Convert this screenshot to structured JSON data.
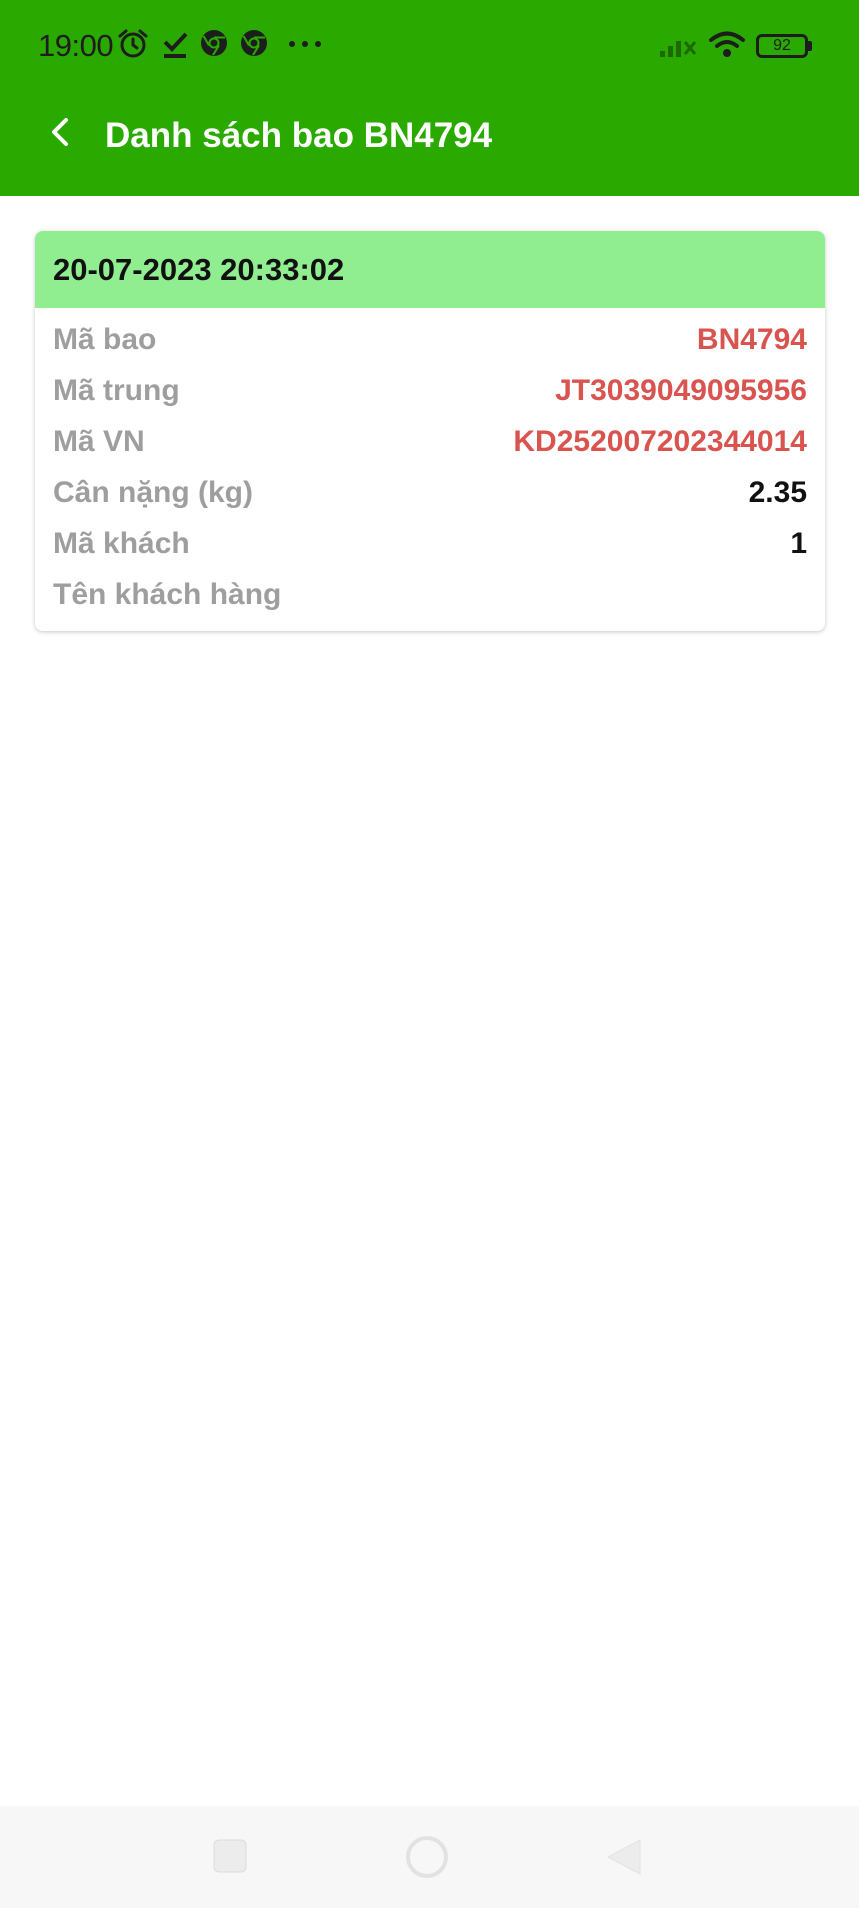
{
  "status_bar": {
    "time": "19:00",
    "battery": "92",
    "icons": [
      "alarm-icon",
      "download-done-icon",
      "chrome-icon",
      "chrome-icon",
      "more-dots-icon",
      "signal-icon",
      "wifi-icon",
      "battery-icon"
    ]
  },
  "app_bar": {
    "title": "Danh sách bao BN4794",
    "color": "#2aaa00"
  },
  "card": {
    "date": "20-07-2023 20:33:02",
    "header_color": "#90ee90",
    "rows": [
      {
        "label": "Mã bao",
        "value": "BN4794",
        "value_color": "#d9534f"
      },
      {
        "label": "Mã trung",
        "value": "JT3039049095956",
        "value_color": "#d9534f"
      },
      {
        "label": "Mã VN",
        "value": "KD252007202344014",
        "value_color": "#d9534f"
      },
      {
        "label": "Cân nặng (kg)",
        "value": "2.35",
        "value_color": "#111111"
      },
      {
        "label": "Mã khách",
        "value": "1",
        "value_color": "#111111"
      },
      {
        "label": "Tên khách hàng",
        "value": "",
        "value_color": "#111111"
      }
    ]
  },
  "nav_bar": {
    "buttons": [
      "recent-apps-icon",
      "home-icon",
      "back-triangle-icon"
    ]
  }
}
